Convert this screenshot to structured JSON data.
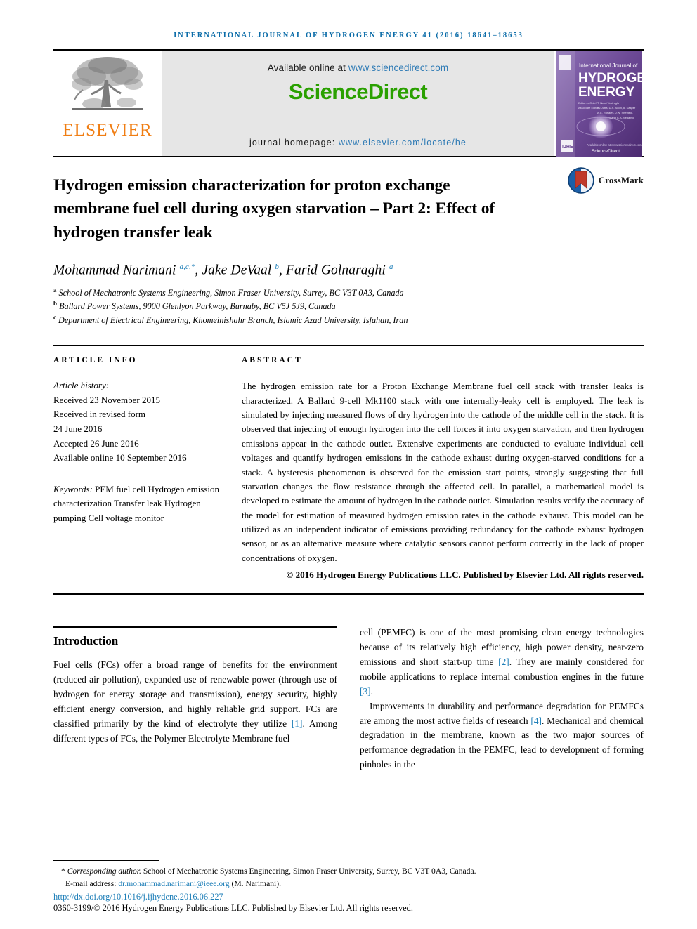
{
  "running_head": "International Journal of Hydrogen Energy 41 (2016) 18641–18653",
  "masthead": {
    "publisher_name": "ELSEVIER",
    "available_prefix": "Available online at ",
    "available_url": "www.sciencedirect.com",
    "sciencedirect_logo": "ScienceDirect",
    "homepage_label": "journal homepage: ",
    "homepage_url": "www.elsevier.com/locate/he",
    "cover": {
      "line1": "International Journal of",
      "line2": "HYDROGEN",
      "line3": "ENERGY",
      "footer_brand": "ScienceDirect",
      "badge": "IJHE"
    },
    "colors": {
      "elsevier_orange": "#f07d12",
      "sciencedirect_green": "#2aa000",
      "link_blue": "#2f7bb5",
      "running_head_blue": "#0b6ca8",
      "masthead_grey": "#e6e6e6",
      "cover_purple": "#6b3f8f"
    }
  },
  "title": "Hydrogen emission characterization for proton exchange membrane fuel cell during oxygen starvation – Part 2: Effect of hydrogen transfer leak",
  "crossmark_label": "CrossMark",
  "authors_html": "Mohammad Narimani <sup>a,c,*</sup>, Jake DeVaal <sup>b</sup>, Farid Golnaraghi <sup>a</sup>",
  "affiliations": [
    {
      "marker": "a",
      "text": "School of Mechatronic Systems Engineering, Simon Fraser University, Surrey, BC V3T 0A3, Canada"
    },
    {
      "marker": "b",
      "text": "Ballard Power Systems, 9000 Glenlyon Parkway, Burnaby, BC V5J 5J9, Canada"
    },
    {
      "marker": "c",
      "text": "Department of Electrical Engineering, Khomeinishahr Branch, Islamic Azad University, Isfahan, Iran"
    }
  ],
  "article_info": {
    "label": "Article info",
    "history_head": "Article history:",
    "history": [
      "Received 23 November 2015",
      "Received in revised form",
      "24 June 2016",
      "Accepted 26 June 2016",
      "Available online 10 September 2016"
    ],
    "keywords_head": "Keywords:",
    "keywords": [
      "PEM fuel cell",
      "Hydrogen emission characterization",
      "Transfer leak",
      "Hydrogen pumping",
      "Cell voltage monitor"
    ]
  },
  "abstract": {
    "label": "Abstract",
    "text": "The hydrogen emission rate for a Proton Exchange Membrane fuel cell stack with transfer leaks is characterized. A Ballard 9-cell Mk1100 stack with one internally-leaky cell is employed. The leak is simulated by injecting measured flows of dry hydrogen into the cathode of the middle cell in the stack. It is observed that injecting of enough hydrogen into the cell forces it into oxygen starvation, and then hydrogen emissions appear in the cathode outlet. Extensive experiments are conducted to evaluate individual cell voltages and quantify hydrogen emissions in the cathode exhaust during oxygen-starved conditions for a stack. A hysteresis phenomenon is observed for the emission start points, strongly suggesting that full starvation changes the flow resistance through the affected cell. In parallel, a mathematical model is developed to estimate the amount of hydrogen in the cathode outlet. Simulation results verify the accuracy of the model for estimation of measured hydrogen emission rates in the cathode exhaust. This model can be utilized as an independent indicator of emissions providing redundancy for the cathode exhaust hydrogen sensor, or as an alternative measure where catalytic sensors cannot perform correctly in the lack of proper concentrations of oxygen.",
    "copyright": "© 2016 Hydrogen Energy Publications LLC. Published by Elsevier Ltd. All rights reserved."
  },
  "introduction": {
    "heading": "Introduction",
    "left_paragraph_1_a": "Fuel cells (FCs) offer a broad range of benefits for the environment (reduced air pollution), expanded use of renewable power (through use of hydrogen for energy storage and transmission), energy security, highly efficient energy conversion, and highly reliable grid support. FCs are classified primarily by the kind of electrolyte they utilize ",
    "ref1": "[1]",
    "left_paragraph_1_b": ". Among different types of FCs, the Polymer Electrolyte Membrane fuel",
    "right_paragraph_1_a": "cell (PEMFC) is one of the most promising clean energy technologies because of its relatively high efficiency, high power density, near-zero emissions and short start-up time ",
    "ref2": "[2]",
    "right_paragraph_1_b": ". They are mainly considered for mobile applications to replace internal combustion engines in the future ",
    "ref3": "[3]",
    "right_paragraph_1_c": ".",
    "right_paragraph_2_a": "Improvements in durability and performance degradation for PEMFCs are among the most active fields of research ",
    "ref4": "[4]",
    "right_paragraph_2_b": ". Mechanical and chemical degradation in the membrane, known as the two major sources of performance degradation in the PEMFC, lead to development of forming pinholes in the"
  },
  "footnote": {
    "corresponding_marker": "*",
    "corresponding_italic": "Corresponding author.",
    "corresponding_text": " School of Mechatronic Systems Engineering, Simon Fraser University, Surrey, BC V3T 0A3, Canada.",
    "email_label": "E-mail address: ",
    "email": "dr.mohammad.narimani@ieee.org",
    "email_suffix": " (M. Narimani).",
    "doi": "http://dx.doi.org/10.1016/j.ijhydene.2016.06.227",
    "issn_copyright": "0360-3199/© 2016 Hydrogen Energy Publications LLC. Published by Elsevier Ltd. All rights reserved."
  }
}
